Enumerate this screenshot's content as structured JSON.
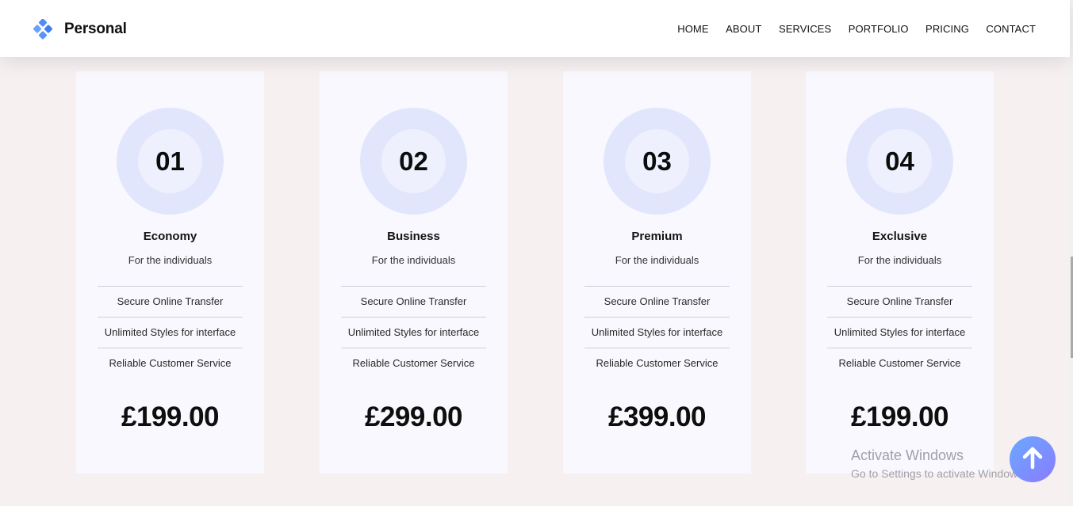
{
  "brand": {
    "name": "Personal",
    "icon": "diamond-cluster-logo-icon"
  },
  "nav": {
    "links": [
      "HOME",
      "ABOUT",
      "SERVICES",
      "PORTFOLIO",
      "PRICING",
      "CONTACT"
    ]
  },
  "plans": [
    {
      "number": "01",
      "title": "Economy",
      "subtitle": "For the individuals",
      "features": [
        "Secure Online Transfer",
        "Unlimited Styles for interface",
        "Reliable Customer Service"
      ],
      "price": "£199.00"
    },
    {
      "number": "02",
      "title": "Business",
      "subtitle": "For the individuals",
      "features": [
        "Secure Online Transfer",
        "Unlimited Styles for interface",
        "Reliable Customer Service"
      ],
      "price": "£299.00"
    },
    {
      "number": "03",
      "title": "Premium",
      "subtitle": "For the individuals",
      "features": [
        "Secure Online Transfer",
        "Unlimited Styles for interface",
        "Reliable Customer Service"
      ],
      "price": "£399.00"
    },
    {
      "number": "04",
      "title": "Exclusive",
      "subtitle": "For the individuals",
      "features": [
        "Secure Online Transfer",
        "Unlimited Styles for interface",
        "Reliable Customer Service"
      ],
      "price": "£199.00"
    }
  ],
  "watermark": {
    "title": "Activate Windows",
    "subtitle": "Go to Settings to activate Windows."
  },
  "back_to_top": {
    "icon": "arrow-up-icon"
  },
  "colors": {
    "page_bg": "#f6f0f1",
    "card_bg": "#f8f8fe",
    "circle_outer": "#e2e6fd",
    "circle_inner": "#eef0fd",
    "accent_gradient_start": "#6aa9ff",
    "accent_gradient_end": "#8a7bff"
  }
}
